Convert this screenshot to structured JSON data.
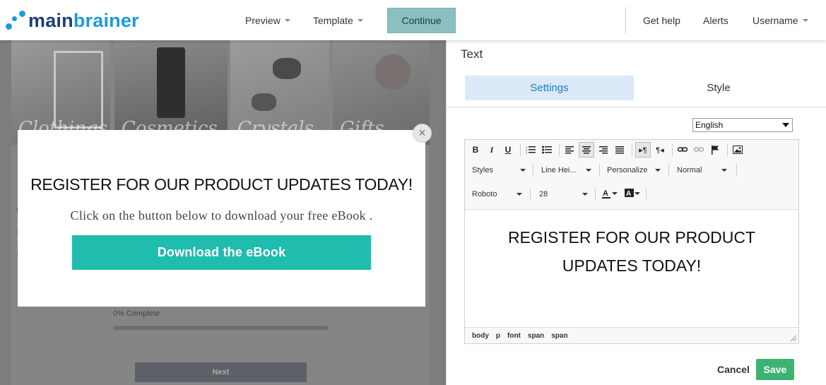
{
  "header": {
    "logo_main": "main",
    "logo_accent": "brainer",
    "preview_label": "Preview",
    "template_label": "Template",
    "continue_label": "Continue",
    "get_help_label": "Get help",
    "alerts_label": "Alerts",
    "username_label": "Username"
  },
  "preview": {
    "tiles": [
      "Clothings",
      "Cosmetics",
      "Crystals",
      "Gifts"
    ],
    "question_label": "Q1",
    "progress_text": "0% Complete",
    "progress_value": 0,
    "next_label": "Next"
  },
  "popup": {
    "title": "REGISTER FOR OUR PRODUCT UPDATES TODAY!",
    "subtitle": "Click on the button below to download your free eBook .",
    "button_label": "Download the eBook",
    "close_icon": "×"
  },
  "panel": {
    "title": "Text",
    "tab_settings": "Settings",
    "tab_style": "Style",
    "language": "English",
    "toolbar": {
      "styles": "Styles",
      "line_height": "Line Hei...",
      "personalize": "Personalize",
      "normal": "Normal",
      "font": "Roboto",
      "size": "28"
    },
    "content_line1": "REGISTER FOR OUR PRODUCT",
    "content_line2": "UPDATES TODAY!",
    "status_path": [
      "body",
      "p",
      "font",
      "span",
      "span"
    ],
    "cancel_label": "Cancel",
    "save_label": "Save"
  },
  "colors": {
    "accent_teal": "#20bcae",
    "continue_bg": "#8cbfbf",
    "tab_active_bg": "#dce9f8",
    "tab_active_text": "#1f7bd0",
    "save_green": "#3cb371",
    "logo_blue": "#1e9bd7",
    "logo_navy": "#1d3f72"
  }
}
